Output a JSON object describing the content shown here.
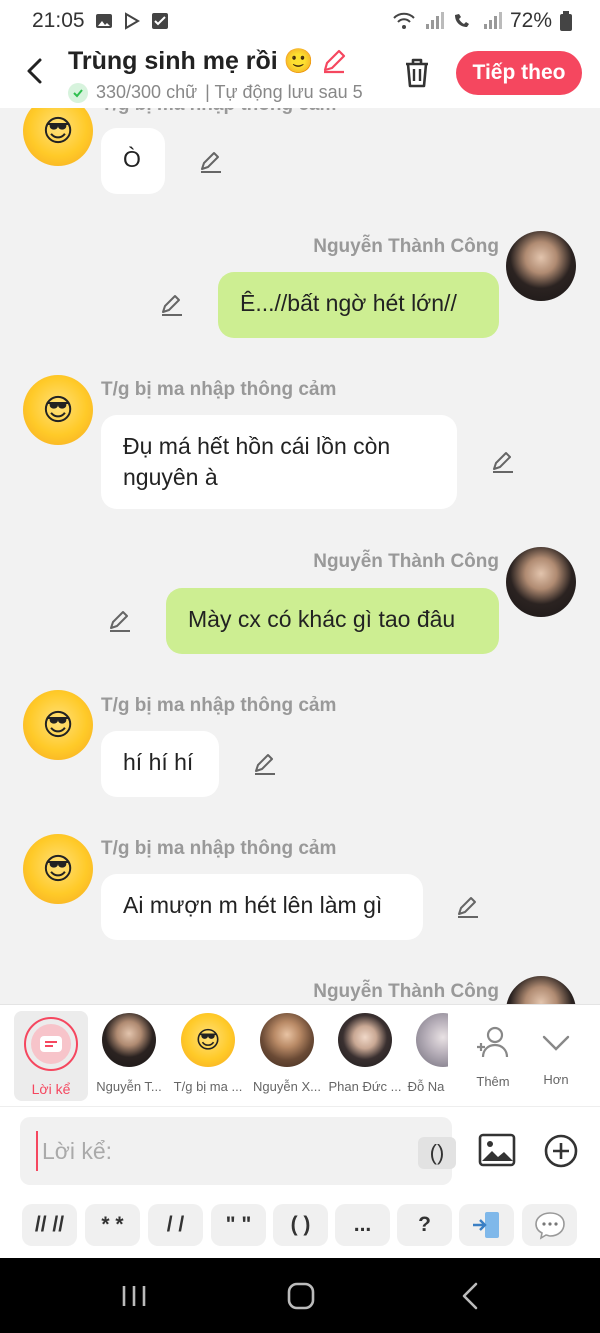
{
  "status_bar": {
    "time": "21:05",
    "battery": "72%"
  },
  "header": {
    "title": "Trùng sinh mẹ rồi",
    "title_emoji": "🙂",
    "word_count": "330/300 chữ",
    "autosave": "| Tự động lưu sau 5",
    "next_label": "Tiếp theo"
  },
  "messages": [
    {
      "sender": "T/g bị ma nhập thông cảm",
      "text": "Ò",
      "side": "left"
    },
    {
      "sender": "Nguyễn Thành Công",
      "text": "Ê...//bất ngờ hét lớn//",
      "side": "right"
    },
    {
      "sender": "T/g bị ma nhập thông cảm",
      "text": "Đụ má hết hồn cái lồn còn nguyên à",
      "side": "left"
    },
    {
      "sender": "Nguyễn Thành Công",
      "text": "Mày cx có khác gì tao đâu",
      "side": "right"
    },
    {
      "sender": "T/g bị ma nhập thông cảm",
      "text": "hí hí hí",
      "side": "left"
    },
    {
      "sender": "T/g bị ma nhập thông cảm",
      "text": "Ai mượn m hét lên làm gì",
      "side": "left"
    },
    {
      "sender": "Nguyễn Thành Công",
      "text": "",
      "side": "right"
    }
  ],
  "characters": {
    "narrator": "Lời kể",
    "items": [
      "Nguyễn T...",
      "T/g bị ma ...",
      "Nguyễn X...",
      "Phan Đức ...",
      "Đỗ Na"
    ],
    "more_label": "Thêm",
    "expand_label": "Hơn"
  },
  "input": {
    "placeholder": "Lời kể:",
    "paren_label": "()"
  },
  "symbols": [
    "// //",
    "* *",
    "/ /",
    "\" \"",
    "( )",
    "...",
    "?"
  ],
  "colors": {
    "accent": "#f5475f",
    "green_bubble": "#cdee92"
  }
}
